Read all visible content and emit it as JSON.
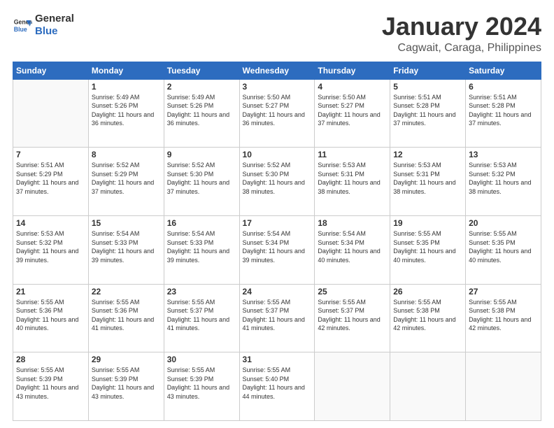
{
  "header": {
    "logo_line1": "General",
    "logo_line2": "Blue",
    "title": "January 2024",
    "subtitle": "Cagwait, Caraga, Philippines"
  },
  "days_of_week": [
    "Sunday",
    "Monday",
    "Tuesday",
    "Wednesday",
    "Thursday",
    "Friday",
    "Saturday"
  ],
  "weeks": [
    [
      {
        "day": "",
        "empty": true
      },
      {
        "day": "1",
        "sunrise": "5:49 AM",
        "sunset": "5:26 PM",
        "daylight": "11 hours and 36 minutes."
      },
      {
        "day": "2",
        "sunrise": "5:49 AM",
        "sunset": "5:26 PM",
        "daylight": "11 hours and 36 minutes."
      },
      {
        "day": "3",
        "sunrise": "5:50 AM",
        "sunset": "5:27 PM",
        "daylight": "11 hours and 36 minutes."
      },
      {
        "day": "4",
        "sunrise": "5:50 AM",
        "sunset": "5:27 PM",
        "daylight": "11 hours and 37 minutes."
      },
      {
        "day": "5",
        "sunrise": "5:51 AM",
        "sunset": "5:28 PM",
        "daylight": "11 hours and 37 minutes."
      },
      {
        "day": "6",
        "sunrise": "5:51 AM",
        "sunset": "5:28 PM",
        "daylight": "11 hours and 37 minutes."
      }
    ],
    [
      {
        "day": "7",
        "sunrise": "5:51 AM",
        "sunset": "5:29 PM",
        "daylight": "11 hours and 37 minutes."
      },
      {
        "day": "8",
        "sunrise": "5:52 AM",
        "sunset": "5:29 PM",
        "daylight": "11 hours and 37 minutes."
      },
      {
        "day": "9",
        "sunrise": "5:52 AM",
        "sunset": "5:30 PM",
        "daylight": "11 hours and 37 minutes."
      },
      {
        "day": "10",
        "sunrise": "5:52 AM",
        "sunset": "5:30 PM",
        "daylight": "11 hours and 38 minutes."
      },
      {
        "day": "11",
        "sunrise": "5:53 AM",
        "sunset": "5:31 PM",
        "daylight": "11 hours and 38 minutes."
      },
      {
        "day": "12",
        "sunrise": "5:53 AM",
        "sunset": "5:31 PM",
        "daylight": "11 hours and 38 minutes."
      },
      {
        "day": "13",
        "sunrise": "5:53 AM",
        "sunset": "5:32 PM",
        "daylight": "11 hours and 38 minutes."
      }
    ],
    [
      {
        "day": "14",
        "sunrise": "5:53 AM",
        "sunset": "5:32 PM",
        "daylight": "11 hours and 39 minutes."
      },
      {
        "day": "15",
        "sunrise": "5:54 AM",
        "sunset": "5:33 PM",
        "daylight": "11 hours and 39 minutes."
      },
      {
        "day": "16",
        "sunrise": "5:54 AM",
        "sunset": "5:33 PM",
        "daylight": "11 hours and 39 minutes."
      },
      {
        "day": "17",
        "sunrise": "5:54 AM",
        "sunset": "5:34 PM",
        "daylight": "11 hours and 39 minutes."
      },
      {
        "day": "18",
        "sunrise": "5:54 AM",
        "sunset": "5:34 PM",
        "daylight": "11 hours and 40 minutes."
      },
      {
        "day": "19",
        "sunrise": "5:55 AM",
        "sunset": "5:35 PM",
        "daylight": "11 hours and 40 minutes."
      },
      {
        "day": "20",
        "sunrise": "5:55 AM",
        "sunset": "5:35 PM",
        "daylight": "11 hours and 40 minutes."
      }
    ],
    [
      {
        "day": "21",
        "sunrise": "5:55 AM",
        "sunset": "5:36 PM",
        "daylight": "11 hours and 40 minutes."
      },
      {
        "day": "22",
        "sunrise": "5:55 AM",
        "sunset": "5:36 PM",
        "daylight": "11 hours and 41 minutes."
      },
      {
        "day": "23",
        "sunrise": "5:55 AM",
        "sunset": "5:37 PM",
        "daylight": "11 hours and 41 minutes."
      },
      {
        "day": "24",
        "sunrise": "5:55 AM",
        "sunset": "5:37 PM",
        "daylight": "11 hours and 41 minutes."
      },
      {
        "day": "25",
        "sunrise": "5:55 AM",
        "sunset": "5:37 PM",
        "daylight": "11 hours and 42 minutes."
      },
      {
        "day": "26",
        "sunrise": "5:55 AM",
        "sunset": "5:38 PM",
        "daylight": "11 hours and 42 minutes."
      },
      {
        "day": "27",
        "sunrise": "5:55 AM",
        "sunset": "5:38 PM",
        "daylight": "11 hours and 42 minutes."
      }
    ],
    [
      {
        "day": "28",
        "sunrise": "5:55 AM",
        "sunset": "5:39 PM",
        "daylight": "11 hours and 43 minutes."
      },
      {
        "day": "29",
        "sunrise": "5:55 AM",
        "sunset": "5:39 PM",
        "daylight": "11 hours and 43 minutes."
      },
      {
        "day": "30",
        "sunrise": "5:55 AM",
        "sunset": "5:39 PM",
        "daylight": "11 hours and 43 minutes."
      },
      {
        "day": "31",
        "sunrise": "5:55 AM",
        "sunset": "5:40 PM",
        "daylight": "11 hours and 44 minutes."
      },
      {
        "day": "",
        "empty": true
      },
      {
        "day": "",
        "empty": true
      },
      {
        "day": "",
        "empty": true
      }
    ]
  ],
  "labels": {
    "sunrise_prefix": "Sunrise: ",
    "sunset_prefix": "Sunset: ",
    "daylight_prefix": "Daylight: "
  }
}
